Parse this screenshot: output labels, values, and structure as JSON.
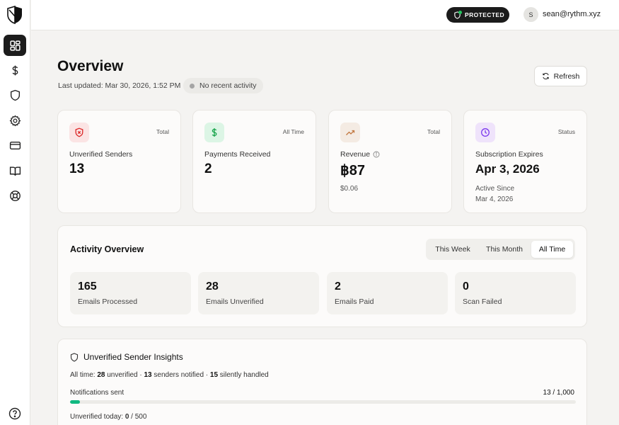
{
  "colors": {
    "accent_dark": "#1b1b1b",
    "protected_dot": "#22c55e",
    "progress_fill": "#10b981",
    "red_icon": "#dc2626",
    "green_icon": "#16a34a",
    "orange_icon": "#c2773f",
    "purple_icon": "#7c3aed"
  },
  "sidebar": {
    "logo_icon": "shield-logo-icon",
    "items": [
      {
        "icon": "dashboard-icon",
        "active": true
      },
      {
        "icon": "dollar-icon",
        "active": false
      },
      {
        "icon": "shield-icon",
        "active": false
      },
      {
        "icon": "gear-icon",
        "active": false
      },
      {
        "icon": "credit-card-icon",
        "active": false
      },
      {
        "icon": "book-icon",
        "active": false
      },
      {
        "icon": "lifebuoy-icon",
        "active": false
      }
    ],
    "help_icon": "question-icon"
  },
  "header": {
    "status_badge": "PROTECTED",
    "avatar_initial": "S",
    "user_email": "sean@rythm.xyz"
  },
  "page": {
    "title": "Overview",
    "last_updated": "Last updated: Mar 30, 2026, 1:52 PM",
    "activity_status": "No recent activity",
    "refresh_label": "Refresh"
  },
  "stats": [
    {
      "icon": "shield-x-icon",
      "tag": "Total",
      "label": "Unverified Senders",
      "value": "13"
    },
    {
      "icon": "dollar-icon",
      "tag": "All Time",
      "label": "Payments Received",
      "value": "2"
    },
    {
      "icon": "trending-up-icon",
      "tag": "Total",
      "label": "Revenue",
      "value": "฿87",
      "sub": "$0.06"
    },
    {
      "icon": "clock-icon",
      "tag": "Status",
      "label": "Subscription Expires",
      "value": "Apr 3, 2026",
      "sub": "Active Since",
      "sub2": "Mar 4, 2026"
    }
  ],
  "activity_overview": {
    "title": "Activity Overview",
    "tabs": [
      "This Week",
      "This Month",
      "All Time"
    ],
    "active_tab": "All Time",
    "metrics": [
      {
        "value": "165",
        "label": "Emails Processed"
      },
      {
        "value": "28",
        "label": "Emails Unverified"
      },
      {
        "value": "2",
        "label": "Emails Paid"
      },
      {
        "value": "0",
        "label": "Scan Failed"
      }
    ]
  },
  "insights": {
    "title": "Unverified Sender Insights",
    "summary_prefix": "All time: ",
    "unverified_count": "28",
    "unverified_text": " unverified · ",
    "notified_count": "13",
    "notified_text": " senders notified · ",
    "handled_count": "15",
    "handled_text": " silently handled",
    "notifications_label": "Notifications sent",
    "notifications_count": "13 / 1,000",
    "notifications_fraction": 0.013,
    "today_prefix": "Unverified today: ",
    "today_count": "0",
    "today_suffix": " / 500"
  }
}
